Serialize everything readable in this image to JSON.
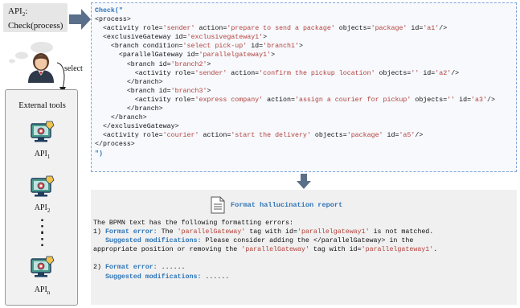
{
  "api_call": {
    "line1_prefix": "API",
    "line1_sub": "2",
    "line1_suffix": ":",
    "line2": "Check(process)"
  },
  "select_label": "select",
  "tools": {
    "title": "External tools",
    "items": [
      {
        "prefix": "API",
        "sub": "1"
      },
      {
        "prefix": "API",
        "sub": "2"
      },
      {
        "prefix": "API",
        "sub": "n"
      }
    ],
    "ellipsis": "⋮"
  },
  "code": {
    "open": "Check(\"",
    "close": "\")",
    "lines": [
      [
        [
          "t",
          "<process>"
        ]
      ],
      [
        [
          "t",
          "  <activity role="
        ],
        [
          "s",
          "'sender'"
        ],
        [
          "t",
          " action="
        ],
        [
          "s",
          "'prepare to send a package'"
        ],
        [
          "t",
          " objects="
        ],
        [
          "s",
          "'package'"
        ],
        [
          "t",
          " id="
        ],
        [
          "s",
          "'a1'"
        ],
        [
          "t",
          "/>"
        ]
      ],
      [
        [
          "t",
          "  <exclusiveGateway id="
        ],
        [
          "s",
          "'exclusivegateway1'"
        ],
        [
          "t",
          ">"
        ]
      ],
      [
        [
          "t",
          "    <branch condition="
        ],
        [
          "s",
          "'select pick-up'"
        ],
        [
          "t",
          " id="
        ],
        [
          "s",
          "'branch1'"
        ],
        [
          "t",
          ">"
        ]
      ],
      [
        [
          "t",
          "      <parallelGateway id="
        ],
        [
          "s",
          "'parallelgateway1'"
        ],
        [
          "t",
          ">"
        ]
      ],
      [
        [
          "t",
          "        <branch id="
        ],
        [
          "s",
          "'branch2'"
        ],
        [
          "t",
          ">"
        ]
      ],
      [
        [
          "t",
          "          <activity role="
        ],
        [
          "s",
          "'sender'"
        ],
        [
          "t",
          " action="
        ],
        [
          "s",
          "'confirm the pickup location'"
        ],
        [
          "t",
          " objects="
        ],
        [
          "s",
          "''"
        ],
        [
          "t",
          " id="
        ],
        [
          "s",
          "'a2'"
        ],
        [
          "t",
          "/>"
        ]
      ],
      [
        [
          "t",
          "        </branch>"
        ]
      ],
      [
        [
          "t",
          "        <branch id="
        ],
        [
          "s",
          "'branch3'"
        ],
        [
          "t",
          ">"
        ]
      ],
      [
        [
          "t",
          "          <activity role="
        ],
        [
          "s",
          "'express company'"
        ],
        [
          "t",
          " action="
        ],
        [
          "s",
          "'assign a courier for pickup'"
        ],
        [
          "t",
          " objects="
        ],
        [
          "s",
          "''"
        ],
        [
          "t",
          " id="
        ],
        [
          "s",
          "'a3'"
        ],
        [
          "t",
          "/>"
        ]
      ],
      [
        [
          "t",
          "        </branch>"
        ]
      ],
      [
        [
          "t",
          "    </branch>"
        ]
      ],
      [
        [
          "t",
          "  </exclusiveGateway>"
        ]
      ],
      [
        [
          "t",
          "  <activity role="
        ],
        [
          "s",
          "'courier'"
        ],
        [
          "t",
          " action="
        ],
        [
          "s",
          "'start the delivery'"
        ],
        [
          "t",
          " objects="
        ],
        [
          "s",
          "'package'"
        ],
        [
          "t",
          " id="
        ],
        [
          "s",
          "'a5'"
        ],
        [
          "t",
          "/>"
        ]
      ],
      [
        [
          "t",
          "</process>"
        ]
      ]
    ]
  },
  "report": {
    "title": "Format hallucination report",
    "lines": [
      [
        [
          "t",
          "The BPMN text has the following formatting errors:"
        ]
      ],
      [
        [
          "t",
          "1) "
        ],
        [
          "b",
          "Format error:"
        ],
        [
          "t",
          " The "
        ],
        [
          "s",
          "'parallelGateway'"
        ],
        [
          "t",
          " tag with id="
        ],
        [
          "s",
          "'parallelgateway1'"
        ],
        [
          "t",
          " is not matched."
        ]
      ],
      [
        [
          "t",
          "   "
        ],
        [
          "b",
          "Suggested modifications:"
        ],
        [
          "t",
          " Please consider adding the </parallelGateway> in the"
        ]
      ],
      [
        [
          "t",
          "appropriate position or removing the "
        ],
        [
          "s",
          "'parallelGateway'"
        ],
        [
          "t",
          " tag with id="
        ],
        [
          "s",
          "'parallelgateway1'"
        ],
        [
          "t",
          "."
        ]
      ],
      [
        [
          "t",
          ""
        ]
      ],
      [
        [
          "t",
          "2) "
        ],
        [
          "b",
          "Format error:"
        ],
        [
          "t",
          " ......"
        ]
      ],
      [
        [
          "t",
          "   "
        ],
        [
          "b",
          "Suggested modifications:"
        ],
        [
          "t",
          " ......"
        ]
      ]
    ]
  },
  "colors": {
    "keyword": "#2f74b5",
    "string": "#b4413b",
    "panel_border": "#7fa6d9",
    "arrow": "#5a6f8a"
  }
}
